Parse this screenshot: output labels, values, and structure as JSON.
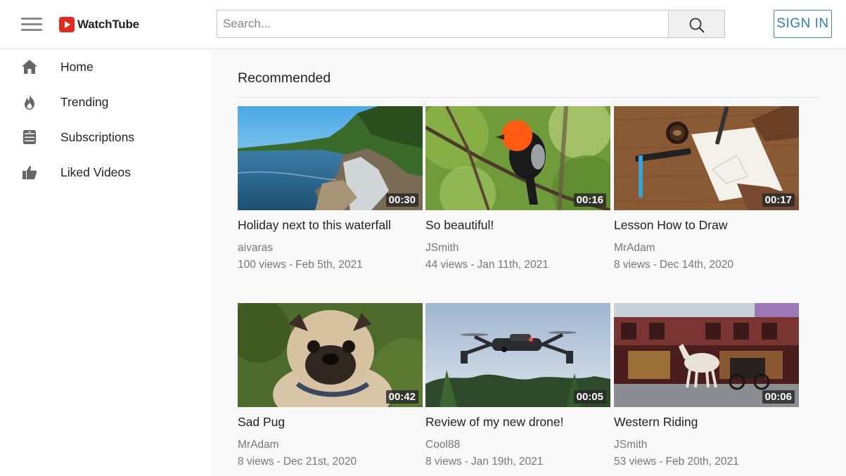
{
  "header": {
    "logo_text": "WatchTube",
    "search_placeholder": "Search...",
    "signin_label": "SIGN IN"
  },
  "sidebar": {
    "items": [
      {
        "label": "Home",
        "icon": "home-icon"
      },
      {
        "label": "Trending",
        "icon": "fire-icon"
      },
      {
        "label": "Subscriptions",
        "icon": "subscriptions-icon"
      },
      {
        "label": "Liked Videos",
        "icon": "thumbs-up-icon"
      }
    ]
  },
  "main": {
    "section_title": "Recommended",
    "videos": [
      {
        "title": "Holiday next to this waterfall",
        "channel": "aivaras",
        "views": "100 views",
        "date": "Feb 5th, 2021",
        "duration": "00:30",
        "thumbnail": "waterfall"
      },
      {
        "title": "So beautiful!",
        "channel": "JSmith",
        "views": "44 views",
        "date": "Jan 11th, 2021",
        "duration": "00:16",
        "thumbnail": "orange-bird"
      },
      {
        "title": "Lesson How to Draw",
        "channel": "MrAdam",
        "views": "8 views",
        "date": "Dec 14th, 2020",
        "duration": "00:17",
        "thumbnail": "drawing-desk"
      },
      {
        "title": "Sad Pug",
        "channel": "MrAdam",
        "views": "8 views",
        "date": "Dec 21st, 2020",
        "duration": "00:42",
        "thumbnail": "pug"
      },
      {
        "title": "Review of my new drone!",
        "channel": "Cool88",
        "views": "8 views",
        "date": "Jan 19th, 2021",
        "duration": "00:05",
        "thumbnail": "drone"
      },
      {
        "title": "Western Riding",
        "channel": "JSmith",
        "views": "53 views",
        "date": "Feb 20th, 2021",
        "duration": "00:06",
        "thumbnail": "horse-carriage"
      }
    ]
  },
  "colors": {
    "brand_red": "#e02b20",
    "signin_blue": "#2f7fc1",
    "sidebar_bg": "#ffffff",
    "main_bg": "#f9f9f9"
  }
}
